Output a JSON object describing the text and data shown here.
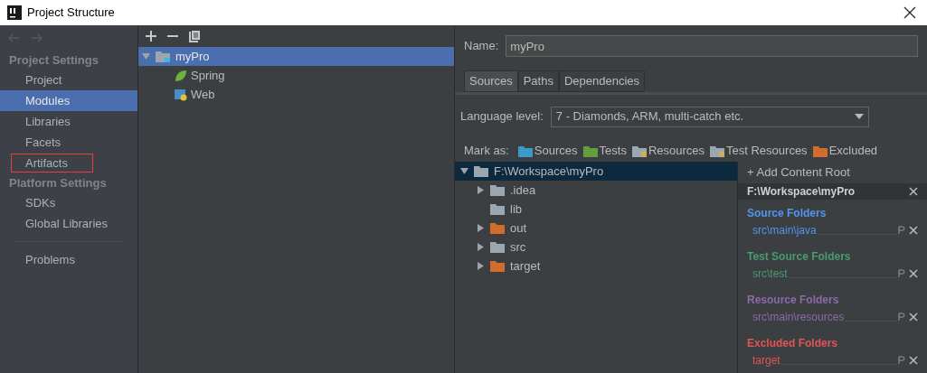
{
  "window": {
    "title": "Project Structure"
  },
  "sidebar": {
    "sections": [
      {
        "heading": "Project Settings",
        "items": [
          {
            "label": "Project",
            "selected": false,
            "highlighted": false
          },
          {
            "label": "Modules",
            "selected": true,
            "highlighted": false
          },
          {
            "label": "Libraries",
            "selected": false,
            "highlighted": false
          },
          {
            "label": "Facets",
            "selected": false,
            "highlighted": false
          },
          {
            "label": "Artifacts",
            "selected": false,
            "highlighted": true
          }
        ]
      },
      {
        "heading": "Platform Settings",
        "items": [
          {
            "label": "SDKs",
            "selected": false,
            "highlighted": false
          },
          {
            "label": "Global Libraries",
            "selected": false,
            "highlighted": false
          }
        ]
      }
    ],
    "footer_items": [
      {
        "label": "Problems",
        "selected": false,
        "highlighted": false
      }
    ]
  },
  "module_tree": [
    {
      "label": "myPro",
      "kind": "module",
      "selected": true,
      "expanded": true,
      "children": [
        {
          "label": "Spring",
          "kind": "spring",
          "selected": false
        },
        {
          "label": "Web",
          "kind": "web",
          "selected": false
        }
      ]
    }
  ],
  "name_field": {
    "label": "Name:",
    "value": "myPro"
  },
  "tabs": [
    {
      "label": "Sources",
      "selected": true
    },
    {
      "label": "Paths",
      "selected": false
    },
    {
      "label": "Dependencies",
      "selected": false
    }
  ],
  "language_level": {
    "label": "Language level:",
    "value": "7 - Diamonds, ARM, multi-catch etc."
  },
  "mark_as": {
    "label": "Mark as:",
    "buttons": [
      {
        "label": "Sources",
        "kind": "sources"
      },
      {
        "label": "Tests",
        "kind": "tests"
      },
      {
        "label": "Resources",
        "kind": "resources"
      },
      {
        "label": "Test Resources",
        "kind": "test_resources"
      },
      {
        "label": "Excluded",
        "kind": "excluded"
      }
    ]
  },
  "content_tree": [
    {
      "label": "F:\\Workspace\\myPro",
      "kind": "plain",
      "selected": true,
      "expanded": true,
      "children": [
        {
          "label": ".idea",
          "kind": "plain",
          "selected": false,
          "expanded": false,
          "has_children": true
        },
        {
          "label": "lib",
          "kind": "plain",
          "selected": false,
          "has_children": false
        },
        {
          "label": "out",
          "kind": "excluded",
          "selected": false,
          "expanded": false,
          "has_children": true
        },
        {
          "label": "src",
          "kind": "plain",
          "selected": false,
          "expanded": false,
          "has_children": true
        },
        {
          "label": "target",
          "kind": "excluded",
          "selected": false,
          "expanded": false,
          "has_children": true
        }
      ]
    }
  ],
  "content_root_panel": {
    "add_button": "+ Add Content Root",
    "root": "F:\\Workspace\\myPro",
    "groups": [
      {
        "title": "Source Folders",
        "color": "#5394ec",
        "paths": [
          "src\\main\\java"
        ]
      },
      {
        "title": "Test Source Folders",
        "color": "#4a9a6e",
        "paths": [
          "src\\test"
        ]
      },
      {
        "title": "Resource Folders",
        "color": "#8a6aa8",
        "paths": [
          "src\\main\\resources"
        ]
      },
      {
        "title": "Excluded Folders",
        "color": "#e05555",
        "paths": [
          "target"
        ]
      }
    ]
  }
}
